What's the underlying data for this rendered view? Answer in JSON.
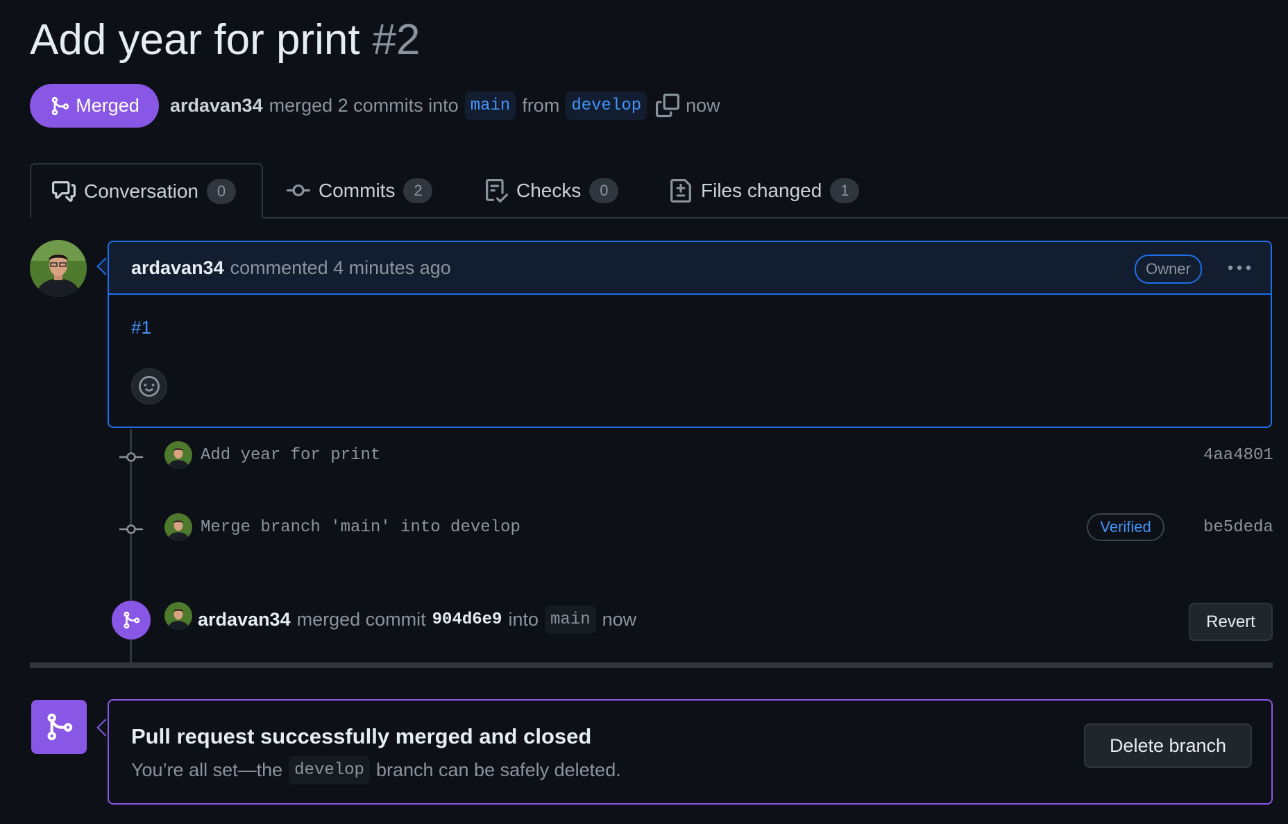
{
  "pr": {
    "title": "Add year for print",
    "number": "#2",
    "status": "Merged",
    "author": "ardavan34",
    "merge_text": "merged 2 commits into",
    "base_branch": "main",
    "from_text": "from",
    "head_branch": "develop",
    "time": "now"
  },
  "tabs": [
    {
      "label": "Conversation",
      "count": "0",
      "icon": "comment-discussion-icon"
    },
    {
      "label": "Commits",
      "count": "2",
      "icon": "git-commit-icon"
    },
    {
      "label": "Checks",
      "count": "0",
      "icon": "checklist-icon"
    },
    {
      "label": "Files changed",
      "count": "1",
      "icon": "file-diff-icon"
    }
  ],
  "comment": {
    "author": "ardavan34",
    "action": "commented 4 minutes ago",
    "role": "Owner",
    "body_link": "#1"
  },
  "commits": [
    {
      "message": "Add year for print",
      "sha": "4aa4801",
      "verified": ""
    },
    {
      "message": "Merge branch 'main' into develop",
      "sha": "be5deda",
      "verified": "Verified"
    }
  ],
  "merge_event": {
    "author": "ardavan34",
    "text1": "merged commit",
    "sha": "904d6e9",
    "text2": "into",
    "branch": "main",
    "time": "now",
    "revert_label": "Revert"
  },
  "merged_box": {
    "title": "Pull request successfully merged and closed",
    "sub_before": "You’re all set—the",
    "branch": "develop",
    "sub_after": "branch can be safely deleted.",
    "delete_label": "Delete branch"
  },
  "colors": {
    "background": "#0d1117",
    "merged_purple": "#8957e5",
    "link_blue": "#4493f8",
    "border": "#30363d"
  }
}
